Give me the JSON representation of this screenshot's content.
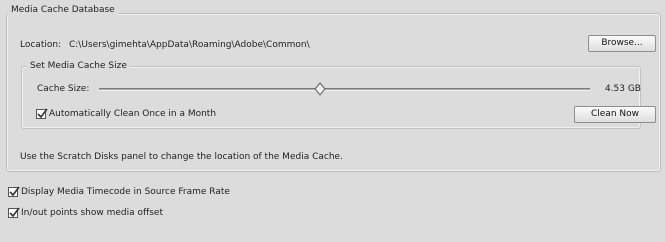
{
  "media_cache_database": {
    "legend": "Media Cache Database",
    "location_label": "Location:",
    "location_path": "C:\\Users\\gimehta\\AppData\\Roaming\\Adobe\\Common\\",
    "browse_label": "Browse...",
    "hint": "Use the Scratch Disks panel to change the location of the Media Cache."
  },
  "cache_size_group": {
    "legend": "Set Media Cache Size",
    "cache_size_label": "Cache Size:",
    "cache_size_value": "4.53 GB",
    "slider_level": 0.45,
    "auto_clean_label": "Automatically Clean Once in a Month",
    "auto_clean_checked": true,
    "clean_now_label": "Clean Now"
  },
  "options": {
    "timecode_label": "Display Media Timecode in Source Frame Rate",
    "timecode_checked": true,
    "inout_label": "In/out points show media offset",
    "inout_checked": true
  },
  "colors": {
    "background": "#dcdcdc",
    "button_border": "#8e8e8e",
    "checkmark": "#333333"
  }
}
